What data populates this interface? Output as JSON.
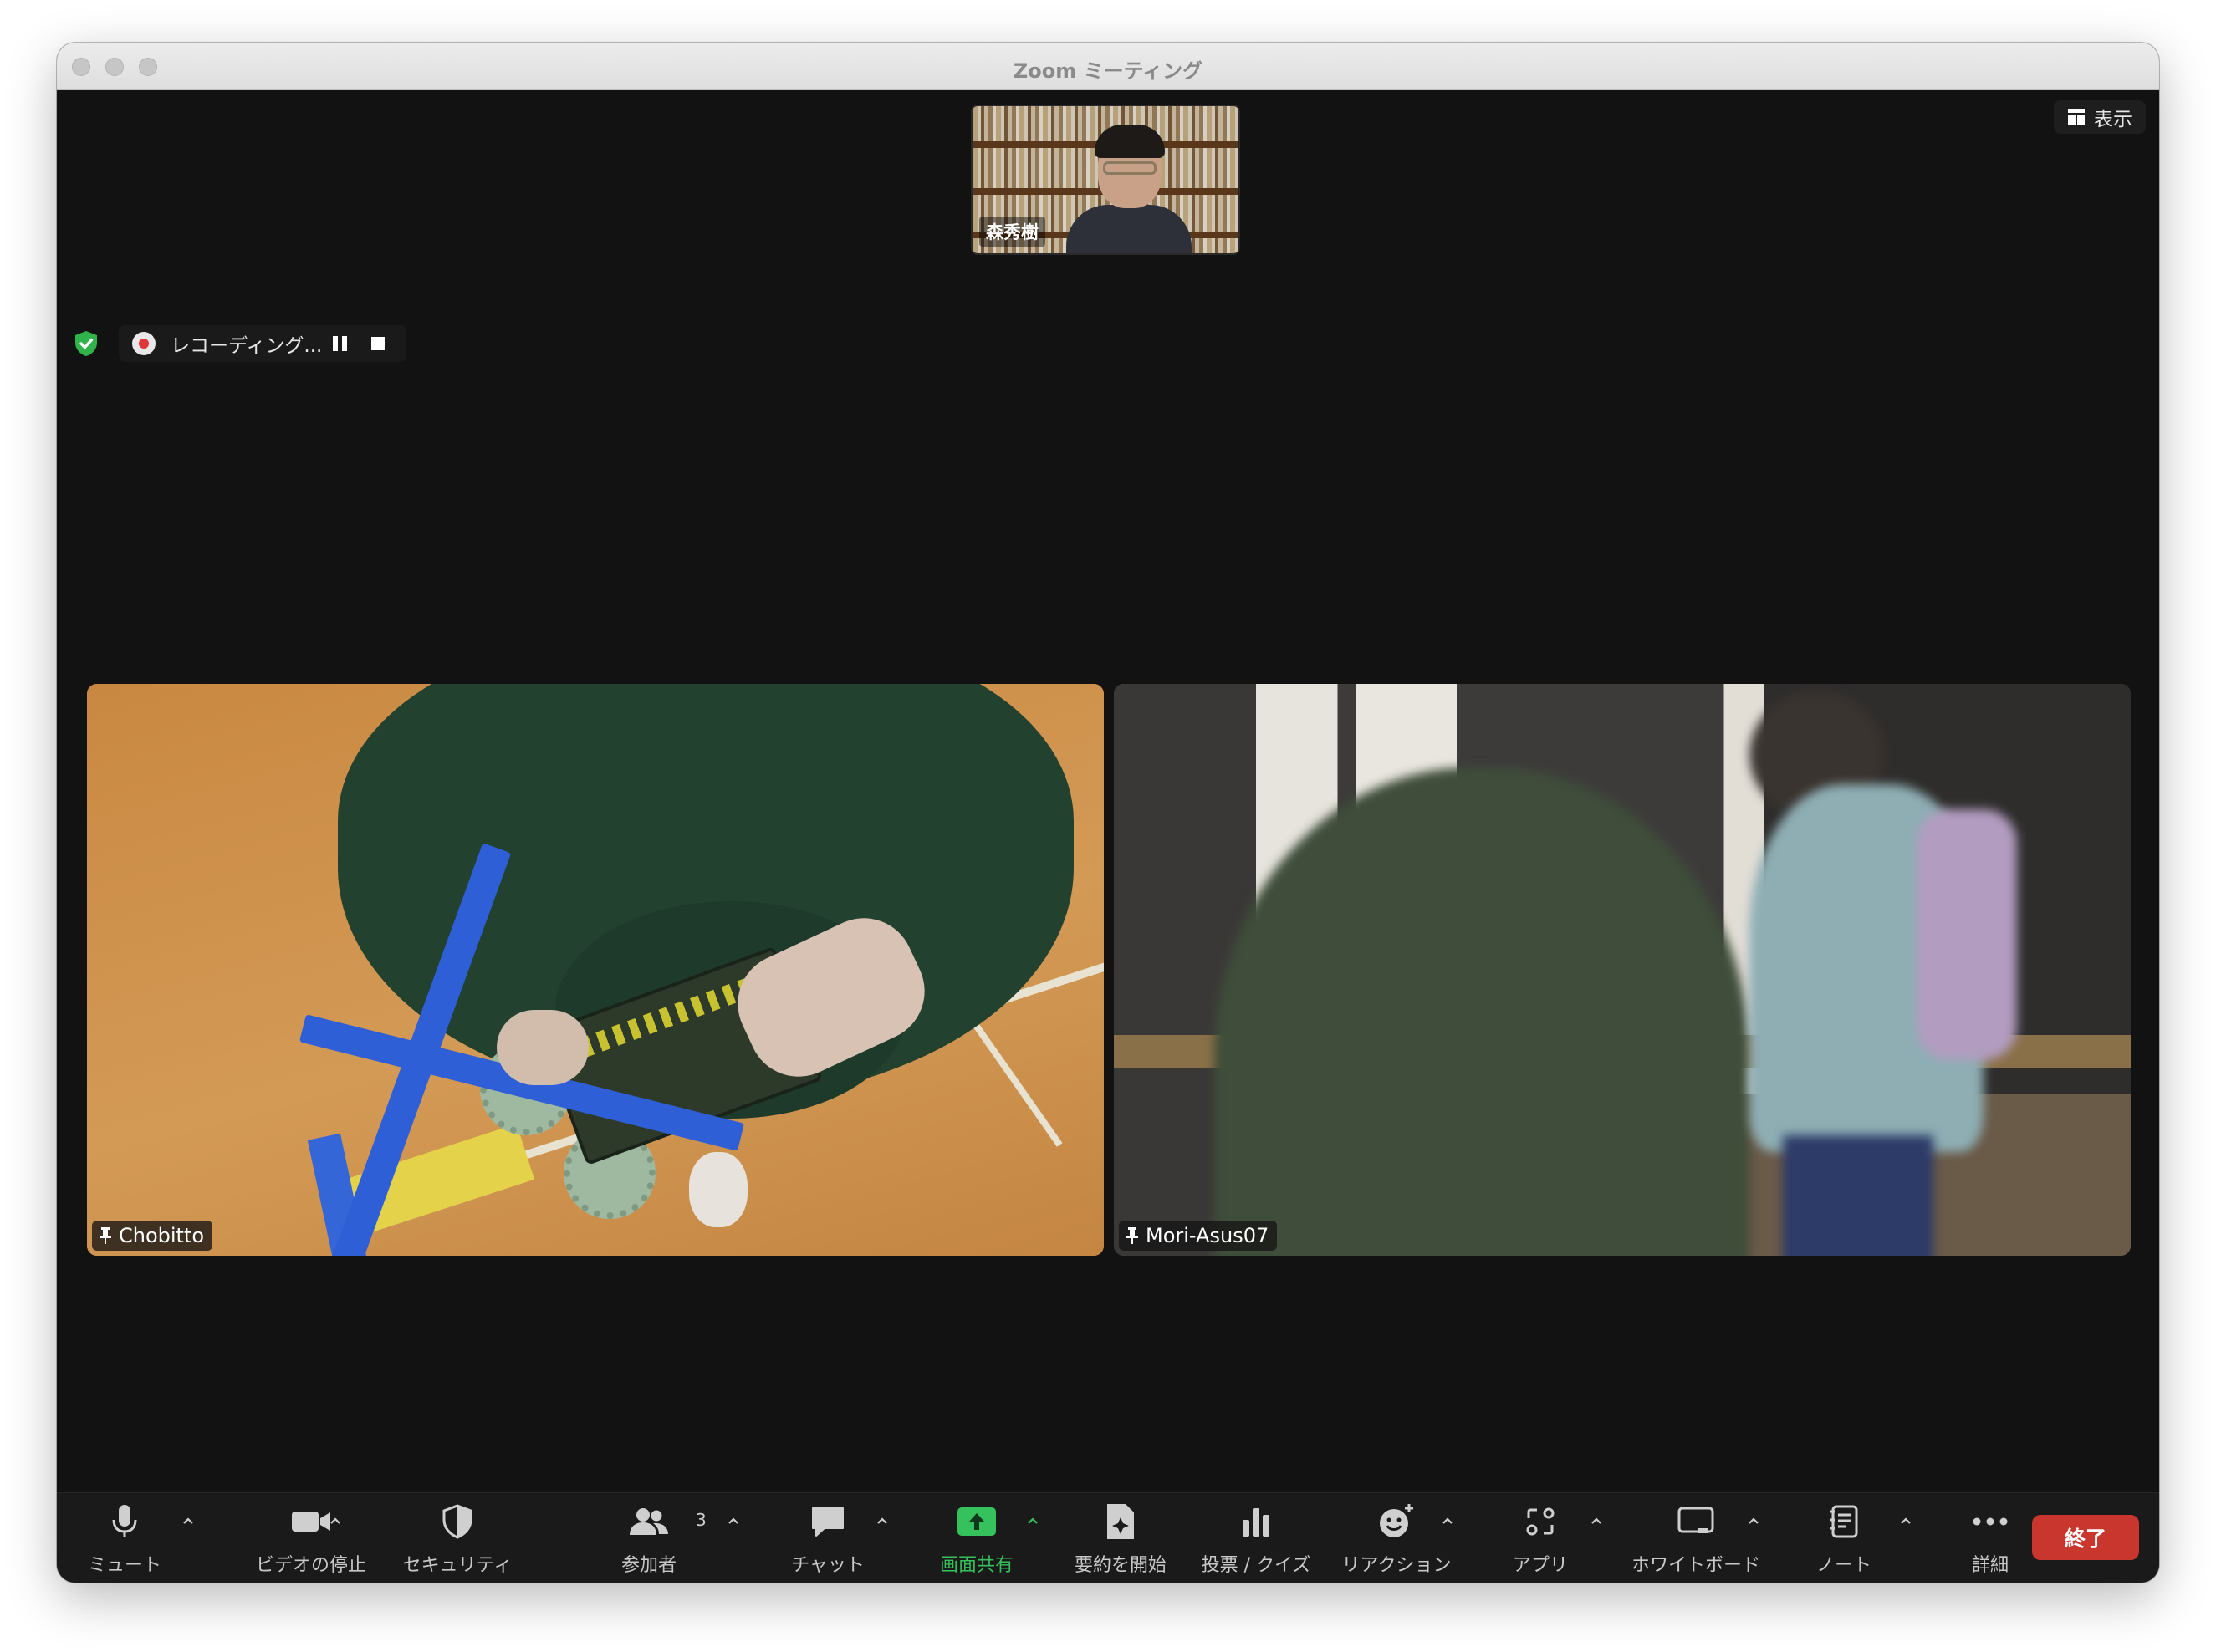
{
  "window": {
    "title": "Zoom ミーティング"
  },
  "view_button": {
    "label": "表示",
    "icon": "grid-icon"
  },
  "self_thumbnail": {
    "name": "森秀樹"
  },
  "recording": {
    "status_text": "レコーディング..."
  },
  "participants": [
    {
      "name": "Chobitto",
      "pinned": true
    },
    {
      "name": "Mori-Asus07",
      "pinned": true
    }
  ],
  "toolbar": {
    "mute": "ミュート",
    "video": "ビデオの停止",
    "security": "セキュリティ",
    "participants": "参加者",
    "participants_count": "3",
    "chat": "チャット",
    "share": "画面共有",
    "summary": "要約を開始",
    "polls": "投票 / クイズ",
    "reactions": "リアクション",
    "apps": "アプリ",
    "whiteboard": "ホワイトボード",
    "notes": "ノート",
    "more": "詳細",
    "end": "終了"
  },
  "colors": {
    "share_green": "#35c15b",
    "end_red": "#c8362d",
    "security_green": "#2fb34a",
    "record_red": "#e0363a"
  }
}
